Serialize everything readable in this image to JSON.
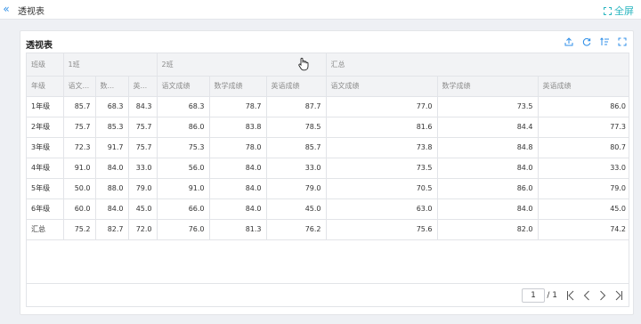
{
  "header": {
    "title": "透视表",
    "fullscreen_label": "全屏"
  },
  "panel": {
    "title": "透视表"
  },
  "table": {
    "corner1": "班级",
    "corner2": "年级",
    "groups": [
      "1班",
      "2班",
      "汇总"
    ],
    "subheaders": [
      "语文...",
      "数...",
      "英...",
      "语文成绩",
      "数学成绩",
      "英语成绩",
      "语文成绩",
      "数学成绩",
      "英语成绩"
    ],
    "rows": [
      [
        "1年级",
        "85.7",
        "68.3",
        "84.3",
        "68.3",
        "78.7",
        "87.7",
        "77.0",
        "73.5",
        "86.0"
      ],
      [
        "2年级",
        "75.7",
        "85.3",
        "75.7",
        "86.0",
        "83.8",
        "78.5",
        "81.6",
        "84.4",
        "77.3"
      ],
      [
        "3年级",
        "72.3",
        "91.7",
        "75.7",
        "75.3",
        "78.0",
        "85.7",
        "73.8",
        "84.8",
        "80.7"
      ],
      [
        "4年级",
        "91.0",
        "84.0",
        "33.0",
        "56.0",
        "84.0",
        "33.0",
        "73.5",
        "84.0",
        "33.0"
      ],
      [
        "5年级",
        "50.0",
        "88.0",
        "79.0",
        "91.0",
        "84.0",
        "79.0",
        "70.5",
        "86.0",
        "79.0"
      ],
      [
        "6年级",
        "60.0",
        "84.0",
        "45.0",
        "66.0",
        "84.0",
        "45.0",
        "63.0",
        "84.0",
        "45.0"
      ],
      [
        "汇总",
        "75.2",
        "82.7",
        "72.0",
        "76.0",
        "81.3",
        "76.2",
        "75.6",
        "82.0",
        "74.2"
      ]
    ]
  },
  "pager": {
    "page": "1",
    "total": "/ 1"
  },
  "colors": {
    "accent": "#2f8fe8",
    "teal": "#2bb6c0",
    "header_bg": "#f2f3f5"
  }
}
